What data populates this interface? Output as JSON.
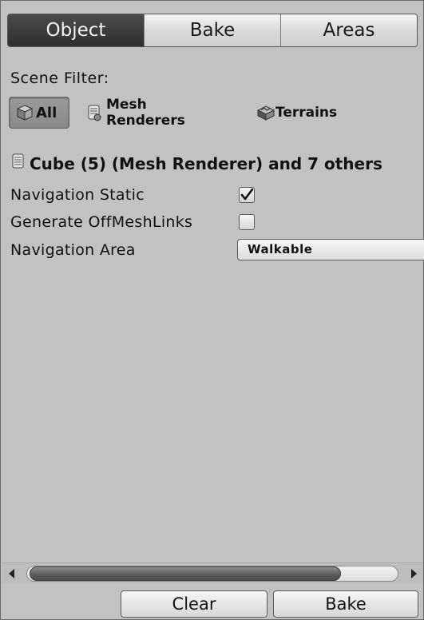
{
  "tabs": [
    {
      "label": "Object",
      "active": true
    },
    {
      "label": "Bake",
      "active": false
    },
    {
      "label": "Areas",
      "active": false
    }
  ],
  "scene_filter": {
    "label": "Scene Filter:",
    "options": [
      {
        "label": "All",
        "icon": "cube-icon",
        "selected": true
      },
      {
        "label": "Mesh Renderers",
        "icon": "mesh-renderer-icon",
        "selected": false
      },
      {
        "label": "Terrains",
        "icon": "terrain-icon",
        "selected": false
      }
    ]
  },
  "selection": {
    "title": "Cube (5) (Mesh Renderer) and 7 others",
    "icon": "mesh-renderer-icon"
  },
  "fields": {
    "navigation_static": {
      "label": "Navigation Static",
      "checked": true
    },
    "generate_offmeshlinks": {
      "label": "Generate OffMeshLinks",
      "checked": false
    },
    "navigation_area": {
      "label": "Navigation Area",
      "value": "Walkable"
    }
  },
  "footer": {
    "clear_label": "Clear",
    "bake_label": "Bake"
  },
  "colors": {
    "panel_bg": "#c2c2c2",
    "active_tab_bg": "#333333",
    "active_tab_text": "#f2f2f2"
  }
}
